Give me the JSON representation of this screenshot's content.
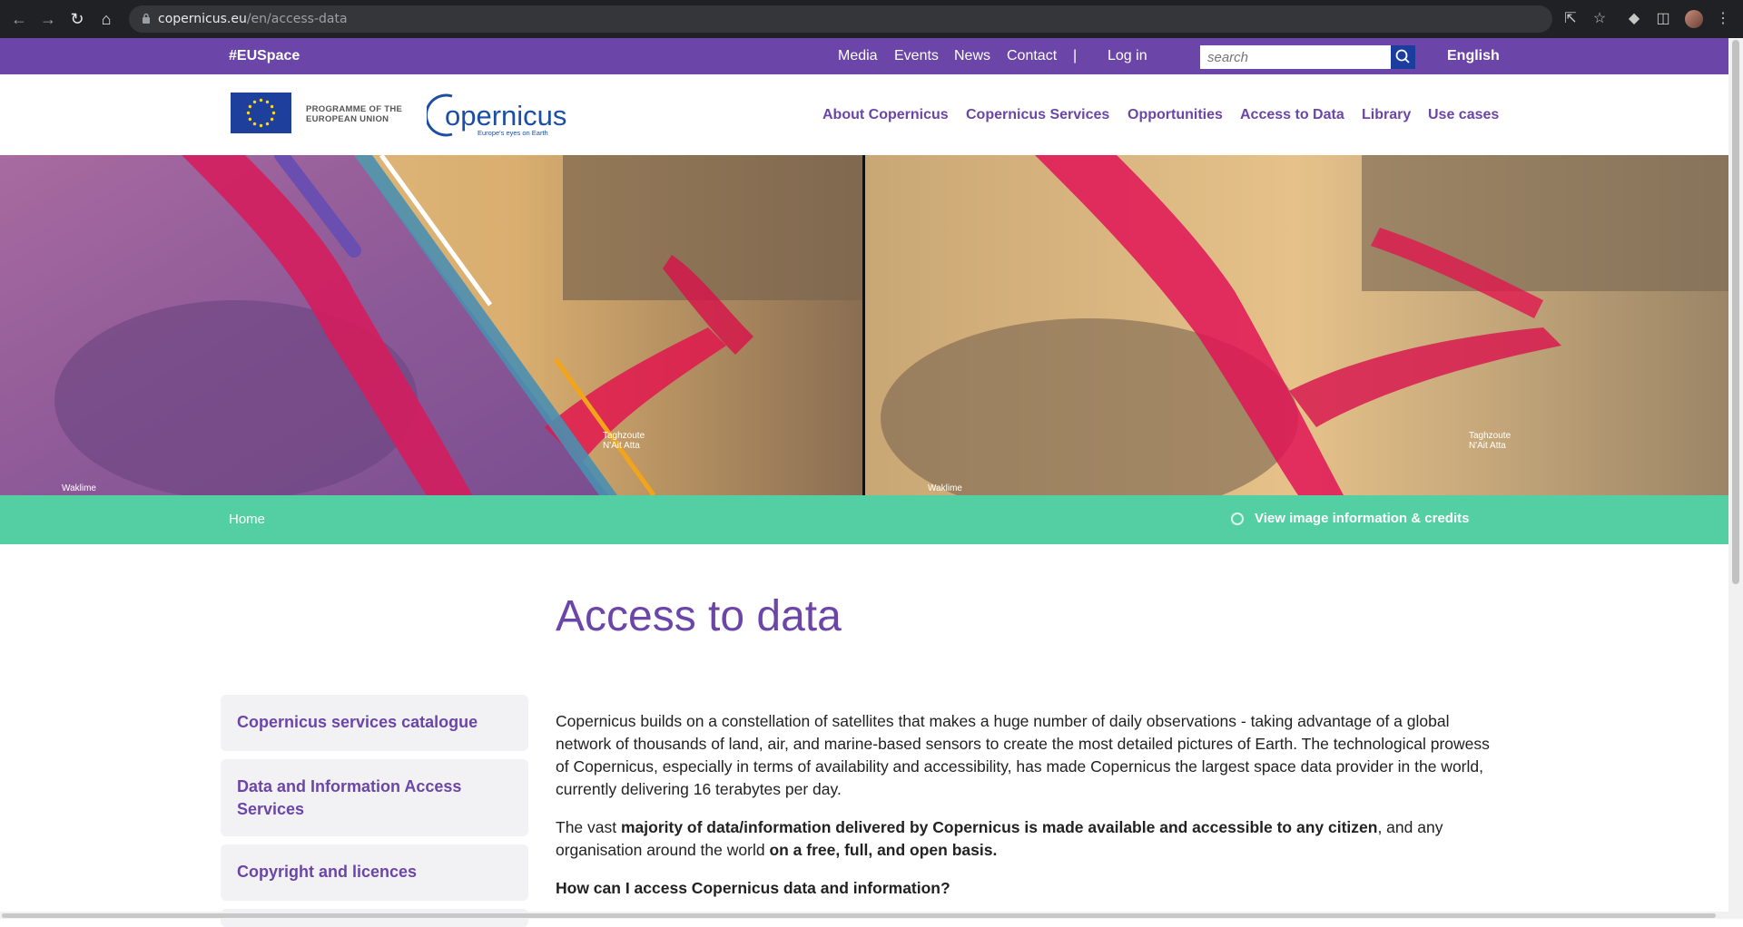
{
  "browser": {
    "url_host": "copernicus.eu",
    "url_path": "/en/access-data"
  },
  "topbar": {
    "hashtag": "#EUSpace",
    "links": [
      "Media",
      "Events",
      "News",
      "Contact"
    ],
    "separator": "|",
    "login": "Log in",
    "search_placeholder": "search",
    "language": "English"
  },
  "header": {
    "eu_line1": "PROGRAMME OF THE",
    "eu_line2": "EUROPEAN UNION",
    "logo_text": "opernicus",
    "logo_tagline": "Europe's eyes on Earth",
    "nav": [
      "About Copernicus",
      "Copernicus Services",
      "Opportunities",
      "Access to Data",
      "Library",
      "Use cases"
    ]
  },
  "hero": {
    "labels": [
      "Waklime",
      "Taghzoute N'Ait Atta",
      "Waklime",
      "Taghzoute N'Ait Atta"
    ]
  },
  "greenbar": {
    "home": "Home",
    "credits": "View image information & credits"
  },
  "main": {
    "title": "Access to data",
    "sidebar": [
      "Copernicus services catalogue",
      "Data and Information Access Services",
      "Copyright and licences"
    ],
    "para1": "Copernicus builds on a constellation of satellites that makes a huge number of daily observations - taking advantage of a global network of thousands of land, air, and marine-based sensors to create the most detailed pictures of Earth. The technological prowess of Copernicus, especially in terms of availability and accessibility, has made Copernicus the largest space data provider in the world, currently delivering 16 terabytes per day.",
    "para2_a": "The vast ",
    "para2_b": "majority of data/information delivered by Copernicus is made available and accessible to any citizen",
    "para2_c": ", and any organisation around the world ",
    "para2_d": "on a free, full, and open basis.",
    "question": "How can I access Copernicus data and information?"
  },
  "colors": {
    "brand_purple": "#6b46a8",
    "accent_green": "#53cfa3",
    "chrome_dark": "#202124"
  }
}
